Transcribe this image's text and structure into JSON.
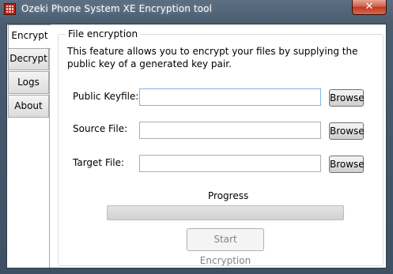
{
  "window": {
    "title": "Ozeki Phone System XE Encryption tool",
    "close_glyph": "✕",
    "app_icon": "grid-app-icon"
  },
  "tabs": [
    {
      "label": "Encrypt",
      "active": true
    },
    {
      "label": "Decrypt",
      "active": false
    },
    {
      "label": "Logs",
      "active": false
    },
    {
      "label": "About",
      "active": false
    }
  ],
  "encrypt": {
    "group_title": "File encryption",
    "description": "This feature allows you to encrypt your files by supplying the public key of a generated key pair.",
    "fields": [
      {
        "label": "Public Keyfile:",
        "value": "",
        "button": "Browse"
      },
      {
        "label": "Source File:",
        "value": "",
        "button": "Browse"
      },
      {
        "label": "Target File:",
        "value": "",
        "button": "Browse"
      }
    ],
    "progress_label": "Progress",
    "progress_value": 0,
    "start_button": "Start Encryption"
  },
  "colors": {
    "accent_close": "#c0391f",
    "progress_fill": "#06b025"
  }
}
